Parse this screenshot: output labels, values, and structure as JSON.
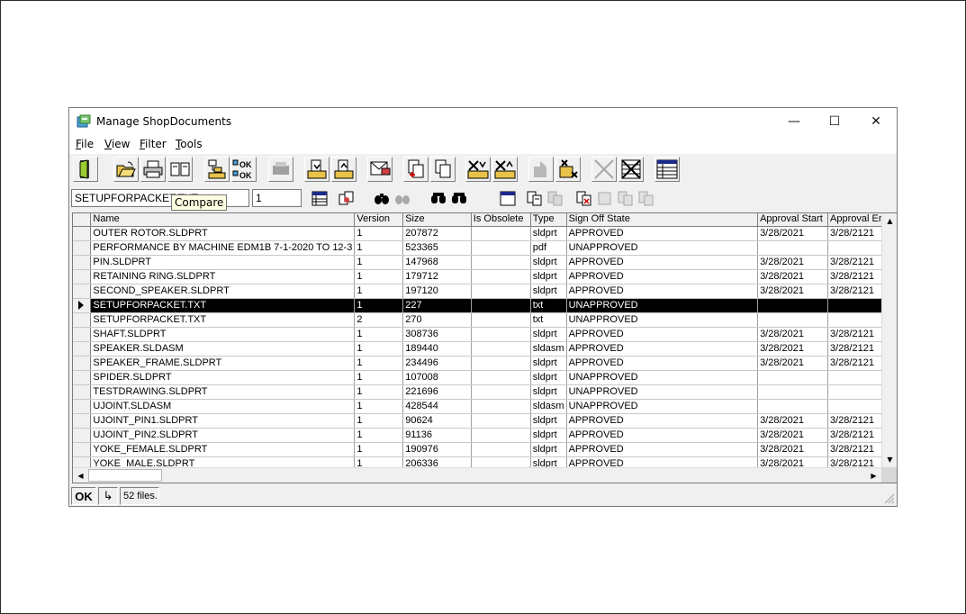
{
  "window": {
    "title": "Manage ShopDocuments",
    "minimize_glyph": "—",
    "maximize_glyph": "☐",
    "close_glyph": "✕"
  },
  "menu": [
    {
      "label": "File",
      "accel": "F",
      "rest": "ile"
    },
    {
      "label": "View",
      "accel": "V",
      "rest": "iew"
    },
    {
      "label": "Filter",
      "accel": "F",
      "rest": "ilter"
    },
    {
      "label": "Tools",
      "accel": "T",
      "rest": "ools"
    }
  ],
  "toolbar2": {
    "file_value": "SETUPFORPACKET.TXT",
    "version_value": "1"
  },
  "tooltip": "Compare",
  "grid": {
    "columns": [
      "Name",
      "Version",
      "Size",
      "Is Obsolete",
      "Type",
      "Sign Off State",
      "Approval Start",
      "Approval End"
    ],
    "rows": [
      {
        "name": "OUTER ROTOR.SLDPRT",
        "version": "1",
        "size": "207872",
        "obsolete": "",
        "type": "sldprt",
        "state": "APPROVED",
        "start": "3/28/2021",
        "end": "3/28/2121"
      },
      {
        "name": "PERFORMANCE BY MACHINE EDM1B 7-1-2020 TO 12-3",
        "version": "1",
        "size": "523365",
        "obsolete": "",
        "type": "pdf",
        "state": "UNAPPROVED",
        "start": "",
        "end": ""
      },
      {
        "name": "PIN.SLDPRT",
        "version": "1",
        "size": "147968",
        "obsolete": "",
        "type": "sldprt",
        "state": "APPROVED",
        "start": "3/28/2021",
        "end": "3/28/2121"
      },
      {
        "name": "RETAINING RING.SLDPRT",
        "version": "1",
        "size": "179712",
        "obsolete": "",
        "type": "sldprt",
        "state": "APPROVED",
        "start": "3/28/2021",
        "end": "3/28/2121"
      },
      {
        "name": "SECOND_SPEAKER.SLDPRT",
        "version": "1",
        "size": "197120",
        "obsolete": "",
        "type": "sldprt",
        "state": "APPROVED",
        "start": "3/28/2021",
        "end": "3/28/2121"
      },
      {
        "name": "SETUPFORPACKET.TXT",
        "version": "1",
        "size": "227",
        "obsolete": "",
        "type": "txt",
        "state": "UNAPPROVED",
        "start": "",
        "end": ""
      },
      {
        "name": "SETUPFORPACKET.TXT",
        "version": "2",
        "size": "270",
        "obsolete": "",
        "type": "txt",
        "state": "UNAPPROVED",
        "start": "",
        "end": ""
      },
      {
        "name": "SHAFT.SLDPRT",
        "version": "1",
        "size": "308736",
        "obsolete": "",
        "type": "sldprt",
        "state": "APPROVED",
        "start": "3/28/2021",
        "end": "3/28/2121"
      },
      {
        "name": "SPEAKER.SLDASM",
        "version": "1",
        "size": "189440",
        "obsolete": "",
        "type": "sldasm",
        "state": "APPROVED",
        "start": "3/28/2021",
        "end": "3/28/2121"
      },
      {
        "name": "SPEAKER_FRAME.SLDPRT",
        "version": "1",
        "size": "234496",
        "obsolete": "",
        "type": "sldprt",
        "state": "APPROVED",
        "start": "3/28/2021",
        "end": "3/28/2121"
      },
      {
        "name": "SPIDER.SLDPRT",
        "version": "1",
        "size": "107008",
        "obsolete": "",
        "type": "sldprt",
        "state": "UNAPPROVED",
        "start": "",
        "end": ""
      },
      {
        "name": "TESTDRAWING.SLDPRT",
        "version": "1",
        "size": "221696",
        "obsolete": "",
        "type": "sldprt",
        "state": "UNAPPROVED",
        "start": "",
        "end": ""
      },
      {
        "name": "UJOINT.SLDASM",
        "version": "1",
        "size": "428544",
        "obsolete": "",
        "type": "sldasm",
        "state": "UNAPPROVED",
        "start": "",
        "end": ""
      },
      {
        "name": "UJOINT_PIN1.SLDPRT",
        "version": "1",
        "size": "90624",
        "obsolete": "",
        "type": "sldprt",
        "state": "APPROVED",
        "start": "3/28/2021",
        "end": "3/28/2121"
      },
      {
        "name": "UJOINT_PIN2.SLDPRT",
        "version": "1",
        "size": "91136",
        "obsolete": "",
        "type": "sldprt",
        "state": "APPROVED",
        "start": "3/28/2021",
        "end": "3/28/2121"
      },
      {
        "name": "YOKE_FEMALE.SLDPRT",
        "version": "1",
        "size": "190976",
        "obsolete": "",
        "type": "sldprt",
        "state": "APPROVED",
        "start": "3/28/2021",
        "end": "3/28/2121"
      },
      {
        "name": "YOKE_MALE.SLDPRT",
        "version": "1",
        "size": "206336",
        "obsolete": "",
        "type": "sldprt",
        "state": "APPROVED",
        "start": "3/28/2021",
        "end": "3/28/2121"
      }
    ],
    "selected_row": 5
  },
  "status": {
    "ok_label": "OK",
    "arrow_glyph": "↳",
    "file_count": "52 files."
  },
  "toolbar_icons": [
    "exit-icon",
    "open-folder-icon",
    "print-icon",
    "book-icon",
    "tree-icon",
    "ok-ok-icon",
    "disabled-printer-icon",
    "check-in-icon",
    "check-out-icon",
    "envelope-icon",
    "add-doc-icon",
    "copy-doc-icon",
    "delete-in-icon",
    "delete-out-icon",
    "disabled-move-icon",
    "remove-icon",
    "disabled-x-icon",
    "delete-grid-icon",
    "grid-window-icon"
  ]
}
